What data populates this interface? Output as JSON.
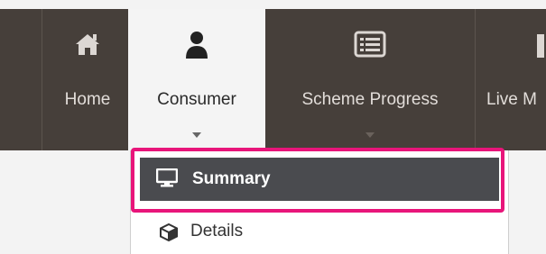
{
  "nav": {
    "items": [
      {
        "label": "Home",
        "icon": "home-icon"
      },
      {
        "label": "Consumer",
        "icon": "user-icon"
      },
      {
        "label": "Scheme Progress",
        "icon": "list-icon"
      },
      {
        "label": "Live M",
        "icon": "partial-icon"
      }
    ],
    "active_index": 1
  },
  "dropdown": {
    "items": [
      {
        "label": "Summary",
        "icon": "monitor-icon",
        "selected": true
      },
      {
        "label": "Details",
        "icon": "cube-icon",
        "selected": false
      }
    ]
  },
  "colors": {
    "navbar": "#463f3a",
    "active_tab": "#f4f4f4",
    "selected_item": "#4a4b4f",
    "highlight": "#e8157a"
  }
}
